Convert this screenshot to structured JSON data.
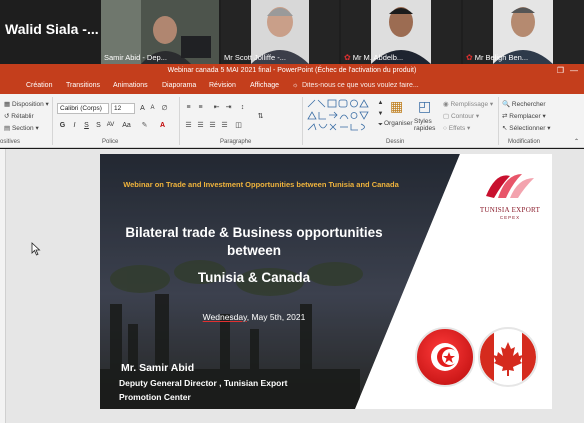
{
  "participants": {
    "active_speaker": "Walid Siala -...",
    "tiles": [
      {
        "name": "Samir Abid - Dep...",
        "muted": false
      },
      {
        "name": "Mr Scott Jolliffe -...",
        "muted": false
      },
      {
        "name": "Mr M. Abdelb...",
        "muted": true
      },
      {
        "name": "Mr Beligh Ben...",
        "muted": true
      }
    ]
  },
  "window": {
    "title": "Webinar canada 5 MAI 2021 final - PowerPoint (Échec de l'activation du produit)"
  },
  "ribbon": {
    "tabs": [
      "Création",
      "Transitions",
      "Animations",
      "Diaporama",
      "Révision",
      "Affichage"
    ],
    "tell_me": "Dites-nous ce que vous voulez faire...",
    "layout_label": "Disposition",
    "reset_label": "Rétablir",
    "section_label": "Section",
    "font_name": "Calibri (Corps)",
    "font_size": "12",
    "arrange_label": "Organiser",
    "quick_styles_label": "Styles rapides",
    "fill_label": "Remplissage",
    "outline_label": "Contour",
    "effects_label": "Effets",
    "find_label": "Rechercher",
    "replace_label": "Remplacer",
    "select_label": "Sélectionner",
    "groups": {
      "slides": "ositives",
      "font": "Police",
      "paragraph": "Paragraphe",
      "drawing": "Dessin",
      "editing": "Modification"
    }
  },
  "slide": {
    "webinar_line": "Webinar on Trade and Investment Opportunities between Tunisia and Canada",
    "title_line1": "Bilateral trade & Business opportunities",
    "title_line2": "between",
    "title_line3": "Tunisia & Canada",
    "date_weekday": "Wednesday",
    "date_rest": ", May 5th, 2021",
    "speaker_name": "Mr. Samir Abid",
    "speaker_role1": "Deputy General Director , Tunisian Export",
    "speaker_role2": "Promotion Center",
    "logo_text": "TUNISIA EXPORT",
    "logo_sub": "CEPEX"
  },
  "colors": {
    "accent": "#c43e1c",
    "slide_gold": "#f0b43c",
    "tunisia_red": "#e31d1c",
    "canada_red": "#d52b1e"
  }
}
